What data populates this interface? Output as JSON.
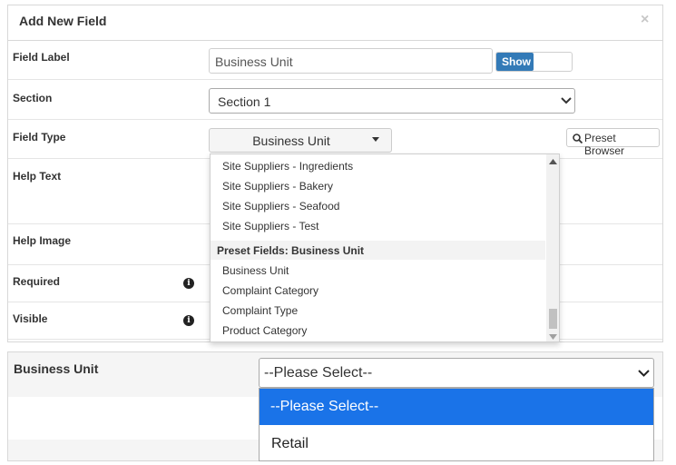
{
  "dialog": {
    "title": "Add New Field",
    "close_glyph": "×",
    "rows": {
      "field_label": {
        "label": "Field Label",
        "value": "Business Unit",
        "toggle_label": "Show"
      },
      "section": {
        "label": "Section",
        "value": "Section 1"
      },
      "field_type": {
        "label": "Field Type",
        "value": "Business Unit",
        "preset_button": "Preset Browser"
      },
      "help_text": {
        "label": "Help Text"
      },
      "help_image": {
        "label": "Help Image"
      },
      "required": {
        "label": "Required"
      },
      "visible": {
        "label": "Visible"
      }
    },
    "dropdown": {
      "items_top": [
        "Site Suppliers - Ingredients",
        "Site Suppliers - Bakery",
        "Site Suppliers - Seafood",
        "Site Suppliers - Test"
      ],
      "group_header": "Preset Fields: Business Unit",
      "items_group": [
        "Business Unit",
        "Complaint Category",
        "Complaint Type",
        "Product Category"
      ]
    }
  },
  "preview": {
    "label": "Business Unit",
    "select_value": "--Please Select--",
    "options": [
      "--Please Select--",
      "Retail"
    ],
    "accent_color": "#1a73e8"
  },
  "colors": {
    "primary_button": "#337ab7",
    "border": "#d8d8d8"
  },
  "icons": {
    "search": "search-icon",
    "info": "info-icon",
    "close": "close-icon",
    "chevron": "chevron-down-icon",
    "caret": "caret-down-icon"
  }
}
